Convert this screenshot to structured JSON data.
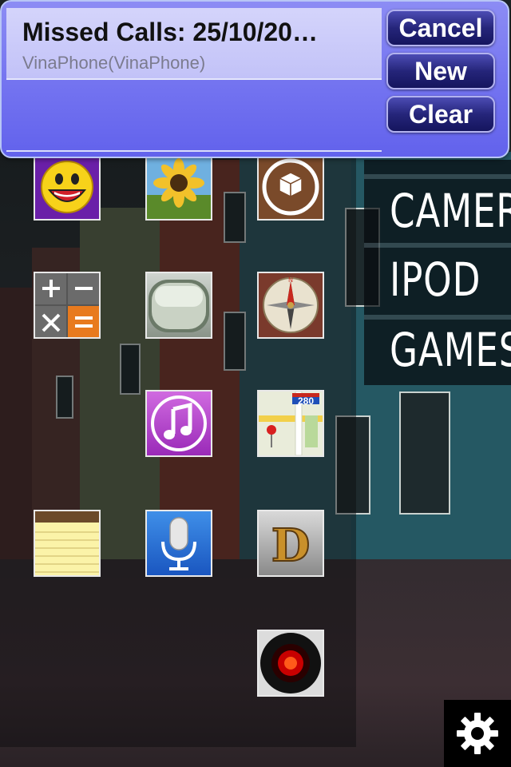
{
  "notification": {
    "title": "Missed Calls: 25/10/20…",
    "subtitle": "VinaPhone(VinaPhone)",
    "buttons": {
      "cancel": "Cancel",
      "new": "New",
      "clear": "Clear"
    }
  },
  "menu": {
    "items": [
      {
        "label": "CAMERA"
      },
      {
        "label": "IPOD"
      },
      {
        "label": "GAMES"
      }
    ]
  },
  "maps_badge": "280",
  "icons": [
    "yahoo-messenger-icon",
    "sunflower-photos-icon",
    "cydia-icon",
    "calculator-icon",
    "sms-bubble-icon",
    "compass-icon",
    "music-icon",
    "maps-icon",
    "notes-icon",
    "voice-memos-icon",
    "d-app-icon",
    "hal-camera-icon"
  ],
  "settings_icon": "gear-icon"
}
